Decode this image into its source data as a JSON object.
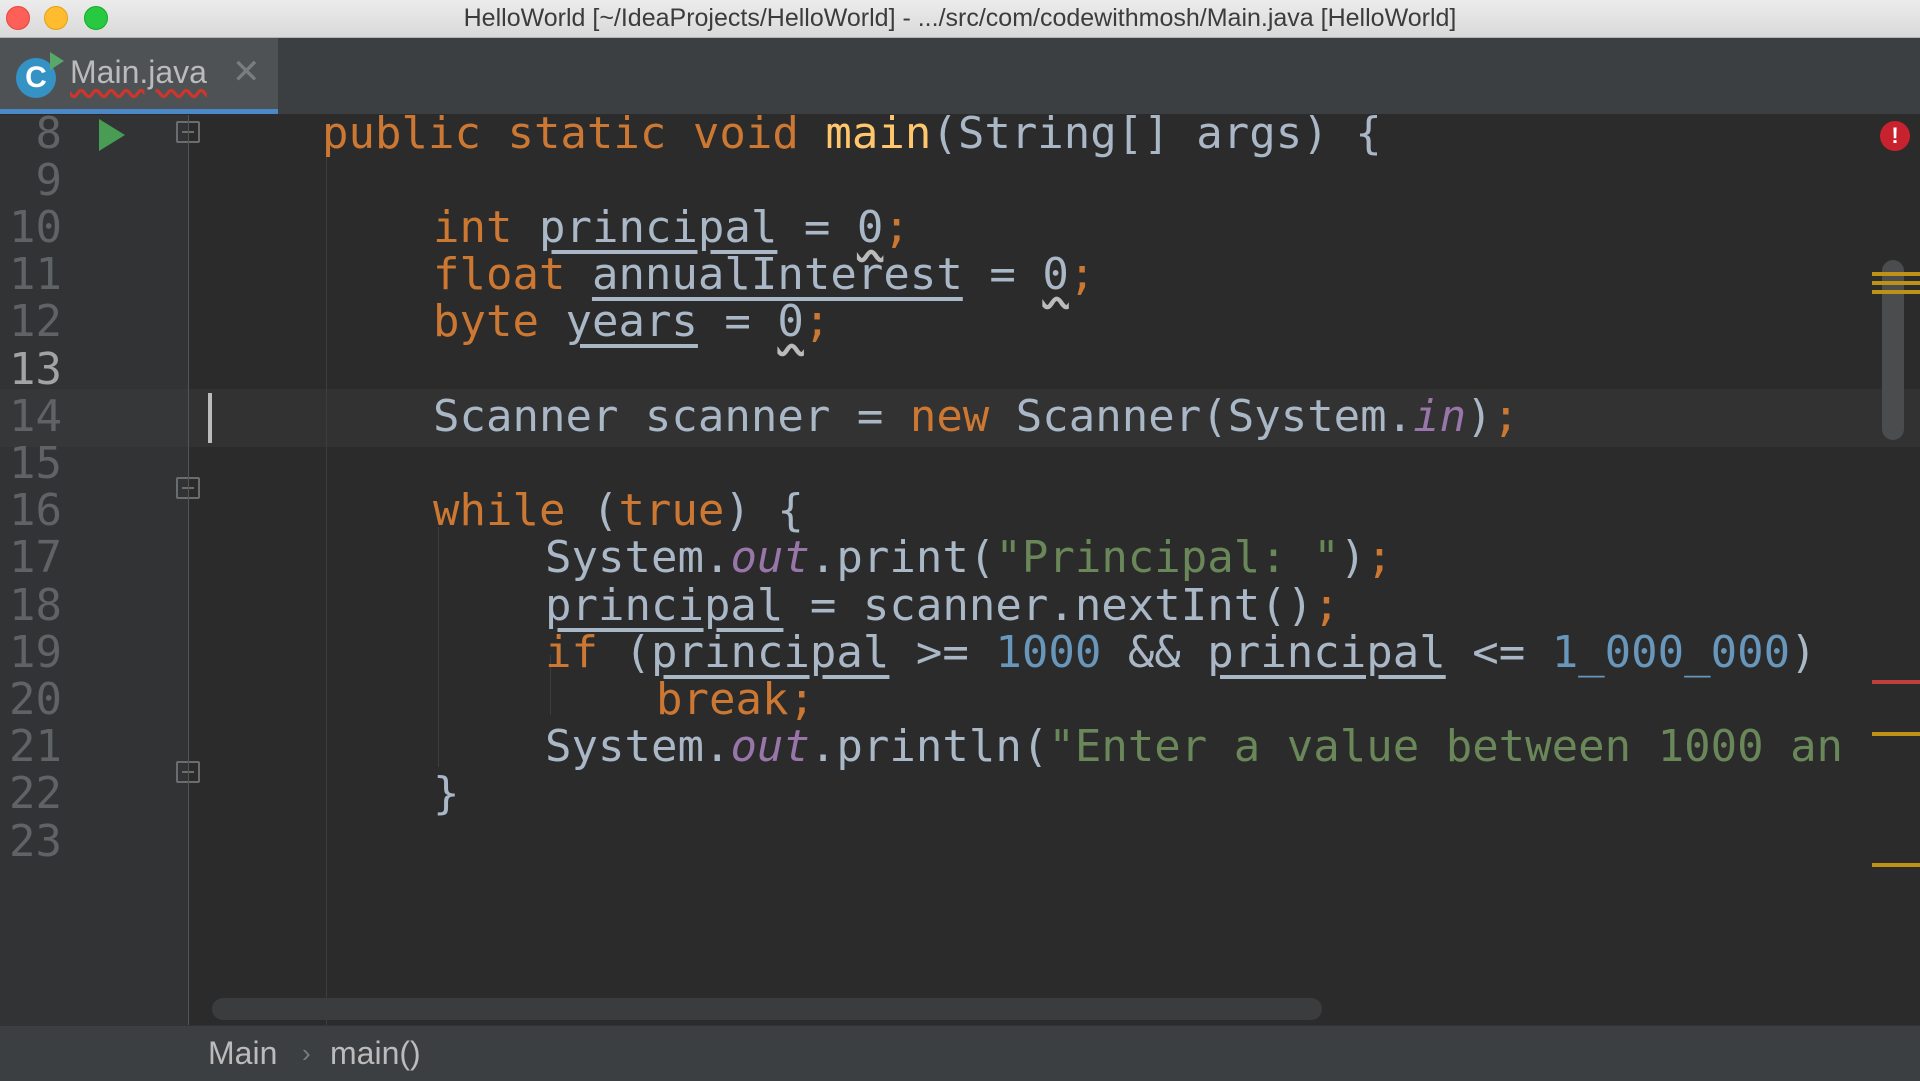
{
  "window": {
    "title": "HelloWorld [~/IdeaProjects/HelloWorld] - .../src/com/codewithmosh/Main.java [HelloWorld]"
  },
  "tabs": [
    {
      "label": "Main.java",
      "icon": "java-class-icon",
      "icon_letter": "C",
      "close": "✕",
      "active": true
    }
  ],
  "editor": {
    "current_line": 13,
    "lines": [
      {
        "num": "8"
      },
      {
        "num": "9"
      },
      {
        "num": "10"
      },
      {
        "num": "11"
      },
      {
        "num": "12"
      },
      {
        "num": "13"
      },
      {
        "num": "14"
      },
      {
        "num": "15"
      },
      {
        "num": "16"
      },
      {
        "num": "17"
      },
      {
        "num": "18"
      },
      {
        "num": "19"
      },
      {
        "num": "20"
      },
      {
        "num": "21"
      },
      {
        "num": "22"
      },
      {
        "num": "23"
      }
    ],
    "tokens": {
      "l8": [
        "public",
        " ",
        "static",
        " ",
        "void",
        " ",
        "main",
        "(String[] args) {"
      ],
      "l10": [
        "int",
        " ",
        "principal",
        " = ",
        "0",
        ";"
      ],
      "l11": [
        "float",
        " ",
        "annualInterest",
        " = ",
        "0",
        ";"
      ],
      "l12": [
        "byte",
        " ",
        "years",
        " = ",
        "0",
        ";"
      ],
      "l14": [
        "Scanner scanner = ",
        "new",
        " Scanner(System.",
        "in",
        ")",
        ";"
      ],
      "l16": [
        "while",
        " (",
        "true",
        ") {"
      ],
      "l17": [
        "System.",
        "out",
        ".print(",
        "\"Principal: \"",
        ")",
        ";"
      ],
      "l18": [
        "principal",
        " = scanner.nextInt()",
        ";"
      ],
      "l19": [
        "if",
        " (",
        "principal",
        " >= ",
        "1000",
        " && ",
        "principal",
        " <= ",
        "1_000_000",
        ")"
      ],
      "l20": [
        "break",
        ";"
      ],
      "l21": [
        "System.",
        "out",
        ".println(",
        "\"Enter a value between 1000 an"
      ],
      "l22": [
        "}"
      ]
    },
    "error_badge": "!",
    "colors": {
      "keyword": "#CC7832",
      "method": "#FFC66D",
      "number": "#6897BB",
      "string": "#6A8759",
      "static_field": "#9876AA",
      "default_text": "#A9B7C6",
      "background": "#2B2B2B"
    }
  },
  "breadcrumb": {
    "items": [
      "Main",
      "main()"
    ],
    "separator": "›"
  }
}
